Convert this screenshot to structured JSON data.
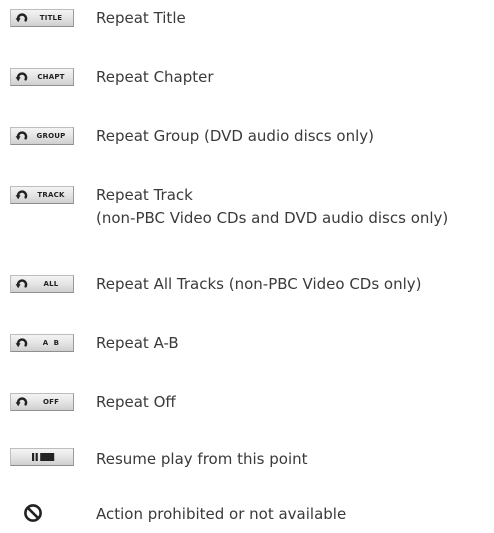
{
  "items": [
    {
      "badge": "TITLE",
      "icon": "repeat-icon",
      "lines": [
        "Repeat Title"
      ]
    },
    {
      "badge": "CHAPT",
      "icon": "repeat-icon",
      "lines": [
        "Repeat Chapter"
      ]
    },
    {
      "badge": "GROUP",
      "icon": "repeat-icon",
      "lines": [
        "Repeat Group (DVD audio discs only)"
      ]
    },
    {
      "badge": "TRACK",
      "icon": "repeat-icon",
      "lines": [
        "Repeat Track",
        "(non-PBC Video CDs and DVD audio discs only)"
      ]
    },
    {
      "badge": "ALL",
      "icon": "repeat-icon",
      "lines": [
        "Repeat All Tracks (non-PBC Video CDs only)"
      ]
    },
    {
      "badge": "A  B",
      "icon": "repeat-icon",
      "lines": [
        "Repeat A-B"
      ]
    },
    {
      "badge": "OFF",
      "icon": "repeat-icon",
      "lines": [
        "Repeat Off"
      ]
    },
    {
      "badge": "",
      "icon": "pause-bars-icon",
      "lines": [
        "Resume play from this point"
      ]
    },
    {
      "badge": "",
      "icon": "prohibited-icon",
      "lines": [
        "Action prohibited or not available"
      ]
    }
  ],
  "colors": {
    "text": "#3a3a3a",
    "badge_fill": "#e6e6e6",
    "badge_border": "#9a9a9a",
    "icon": "#222222"
  }
}
